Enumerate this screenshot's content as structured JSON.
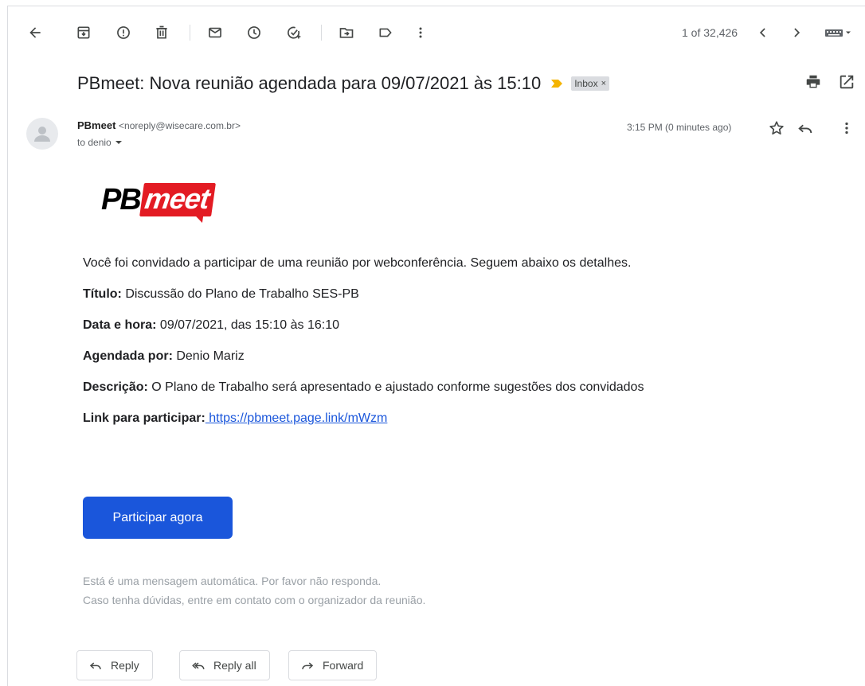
{
  "toolbar": {
    "pager": "1 of 32,426"
  },
  "email": {
    "subject": "PBmeet: Nova reunião agendada para 09/07/2021 às 15:10",
    "label": "Inbox",
    "label_close": "×",
    "sender_name": "PBmeet",
    "sender_email": "<noreply@wisecare.com.br>",
    "recipient": "to denio",
    "time": "3:15 PM (0 minutes ago)"
  },
  "logo": {
    "part1": "PB",
    "part2": "meet"
  },
  "body": {
    "intro": "Você foi convidado a participar de uma reunião por webconferência. Seguem abaixo os detalhes.",
    "title_label": "Título:",
    "title_value": " Discussão do Plano de Trabalho SES-PB",
    "date_label": "Data e hora:",
    "date_value": " 09/07/2021, das 15:10 às 16:10",
    "scheduler_label": "Agendada por:",
    "scheduler_value": " Denio Mariz",
    "description_label": "Descrição:",
    "description_value": " O Plano de Trabalho será apresentado e ajustado conforme sugestões dos convidados",
    "link_label": "Link para participar:",
    "link_url": " https://pbmeet.page.link/mWzm",
    "cta": "Participar agora",
    "footnote_1": "Está é uma mensagem automática. Por favor não responda.",
    "footnote_2": "Caso tenha dúvidas, entre em contato com o organizador da reunião."
  },
  "actions": {
    "reply": "Reply",
    "reply_all": "Reply all",
    "forward": "Forward"
  },
  "colors": {
    "accent": "#1a56db",
    "brand_red": "#e31b23",
    "importance": "#f4b400"
  }
}
